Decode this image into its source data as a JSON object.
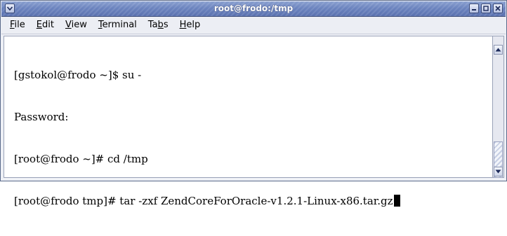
{
  "window": {
    "title": "root@frodo:/tmp"
  },
  "menu": {
    "items": [
      {
        "label": "File",
        "underline": "F",
        "rest": "ile"
      },
      {
        "label": "Edit",
        "underline": "E",
        "rest": "dit"
      },
      {
        "label": "View",
        "underline": "V",
        "rest": "iew"
      },
      {
        "label": "Terminal",
        "underline": "T",
        "rest": "erminal"
      },
      {
        "label": "Tabs",
        "prefix": "Ta",
        "underline": "b",
        "rest": "s"
      },
      {
        "label": "Help",
        "underline": "H",
        "rest": "elp"
      }
    ]
  },
  "terminal": {
    "lines": [
      "[gstokol@frodo ~]$ su -",
      "Password:",
      "[root@frodo ~]# cd /tmp",
      "[root@frodo tmp]# tar -zxf ZendCoreForOracle-v1.2.1-Linux-x86.tar.gz"
    ]
  },
  "colors": {
    "titlebar": "#6c84bf",
    "title_text": "#ffffff",
    "terminal_bg": "#ffffff",
    "terminal_fg": "#000000"
  },
  "icons": {
    "window_menu": "chevron-down-icon",
    "minimize": "minimize-icon",
    "maximize": "maximize-icon",
    "close": "close-icon",
    "scroll_up": "arrow-up-icon",
    "scroll_down": "arrow-down-icon"
  }
}
